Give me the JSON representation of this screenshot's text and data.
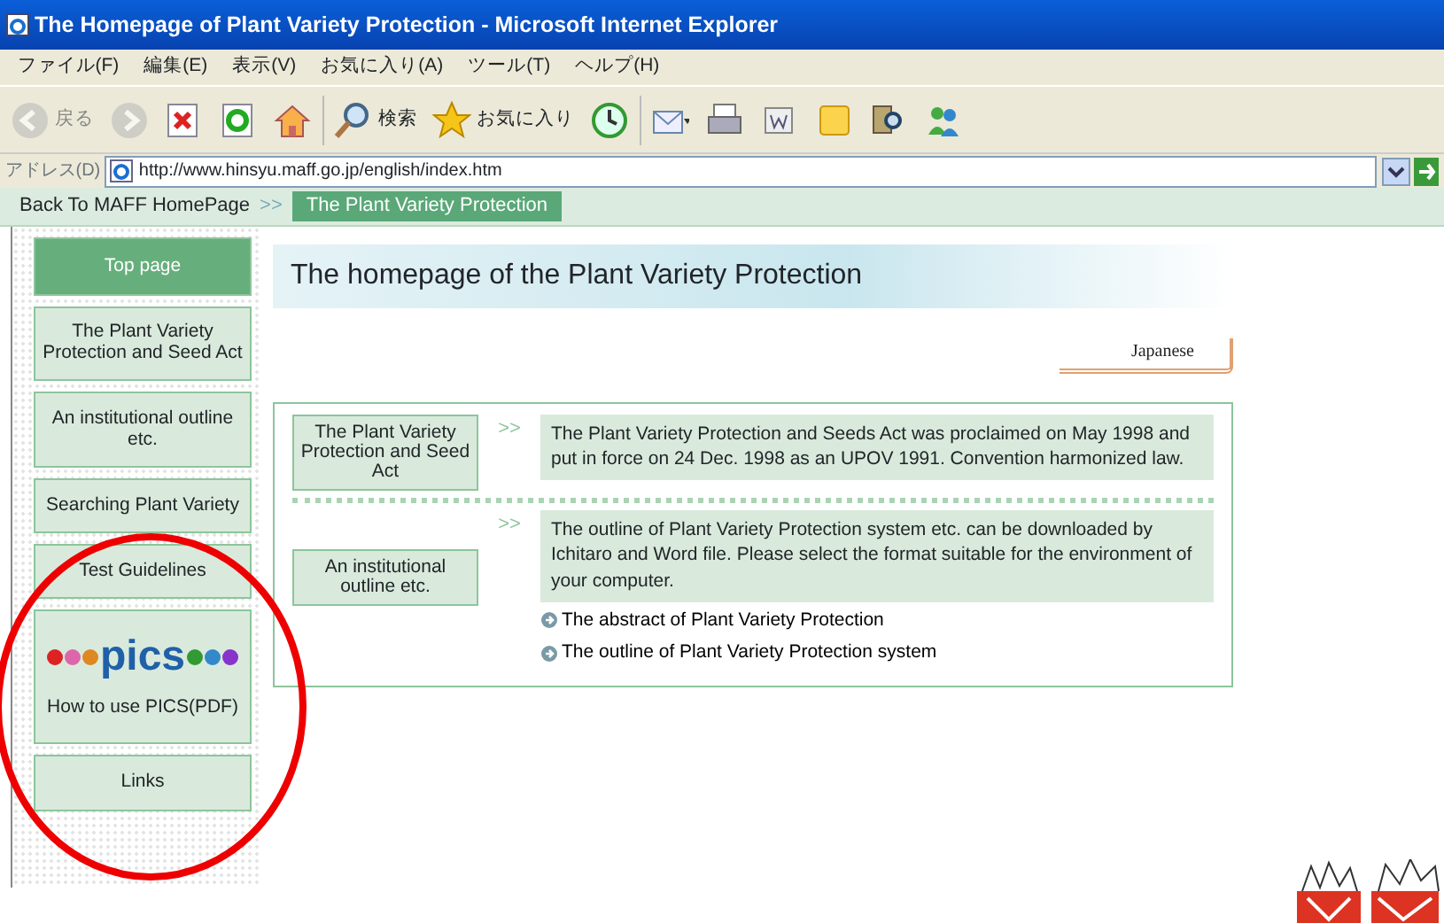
{
  "window": {
    "title": "The Homepage of Plant Variety Protection - Microsoft Internet Explorer"
  },
  "menu": [
    "ファイル(F)",
    "編集(E)",
    "表示(V)",
    "お気に入り(A)",
    "ツール(T)",
    "ヘルプ(H)"
  ],
  "toolbar": [
    {
      "kind": "back",
      "label": "戻る",
      "disabled": true
    },
    {
      "kind": "forward",
      "disabled": true
    },
    {
      "kind": "stop",
      "disabled": false
    },
    {
      "kind": "refresh",
      "disabled": false
    },
    {
      "kind": "home",
      "disabled": false
    },
    {
      "kind": "search",
      "label": "検索",
      "disabled": false
    },
    {
      "kind": "favorites",
      "label": "お気に入り",
      "disabled": false
    },
    {
      "kind": "history",
      "disabled": false
    },
    {
      "kind": "mail",
      "disabled": false
    },
    {
      "kind": "print",
      "disabled": false
    },
    {
      "kind": "edit",
      "disabled": false
    },
    {
      "kind": "note",
      "disabled": false
    },
    {
      "kind": "research",
      "disabled": false
    },
    {
      "kind": "messenger",
      "disabled": false
    }
  ],
  "address": {
    "label": "アドレス(D)",
    "url": "http://www.hinsyu.maff.go.jp/english/index.htm"
  },
  "breadcrumb": {
    "link": "Back To MAFF HomePage",
    "separator": ">>",
    "current": "The Plant Variety Protection"
  },
  "sidebar": {
    "items": [
      {
        "kind": "text",
        "label": "Top page",
        "selected": true
      },
      {
        "kind": "text",
        "label": "The Plant Variety Protection and Seed Act",
        "selected": false
      },
      {
        "kind": "text",
        "label": "An institutional outline etc.",
        "selected": false
      },
      {
        "kind": "text",
        "label": "Searching Plant Variety",
        "selected": false
      },
      {
        "kind": "text",
        "label": "Test Guidelines",
        "selected": false
      },
      {
        "kind": "logo",
        "logo": "pics",
        "label": "How to use PICS(PDF)",
        "selected": false
      },
      {
        "kind": "text",
        "label": "Links",
        "selected": false
      }
    ]
  },
  "header": {
    "title": "The homepage of the Plant Variety Protection",
    "language_link": "Japanese"
  },
  "sections": [
    {
      "button": "The Plant Variety Protection and Seed Act",
      "arrow": ">>",
      "text": "The Plant Variety Protection and Seeds Act was proclaimed on May 1998 and put in force on 24 Dec. 1998 as an UPOV 1991. Convention harmonized law."
    },
    {
      "button": "An institutional outline etc.",
      "arrow": ">>",
      "text": "The outline of Plant Variety Protection system etc. can be downloaded by Ichitaro and Word file. Please select the format suitable for the environment of your computer.",
      "links": [
        "The abstract of Plant Variety Protection",
        "The outline of Plant Variety Protection system"
      ]
    }
  ]
}
